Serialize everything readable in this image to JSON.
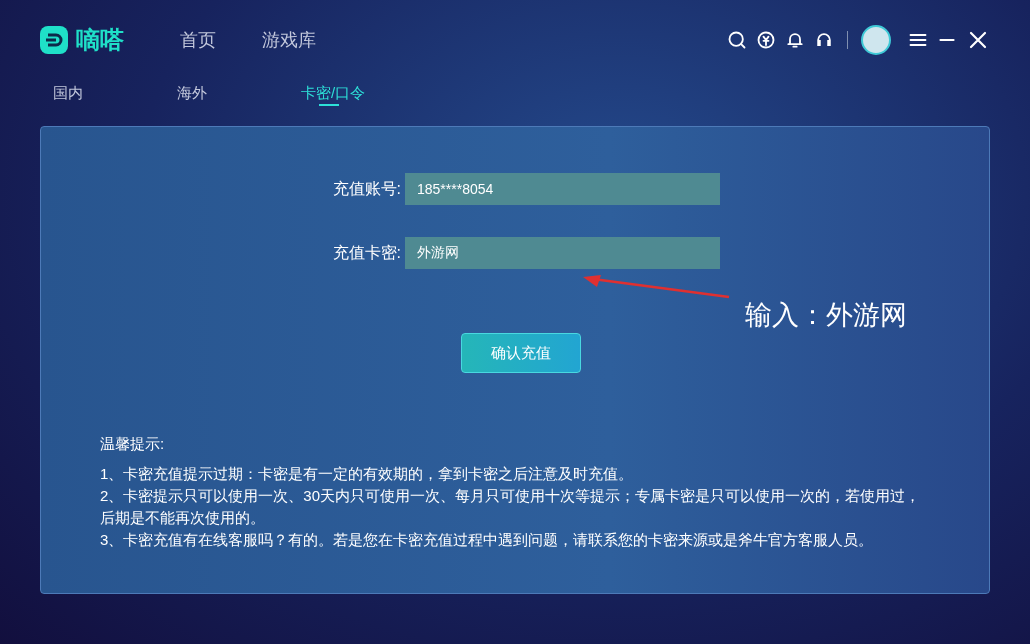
{
  "app": {
    "logo_text": "嘀嗒"
  },
  "nav": [
    {
      "label": "首页",
      "selected": false
    },
    {
      "label": "游戏库",
      "selected": false
    }
  ],
  "subtabs": [
    {
      "label": "国内",
      "selected": false
    },
    {
      "label": "海外",
      "selected": false
    },
    {
      "label": "卡密/口令",
      "selected": true
    }
  ],
  "form": {
    "fields": [
      {
        "label": "充值账号:",
        "value": "185****8054"
      },
      {
        "label": "充值卡密:",
        "value": "外游网"
      }
    ],
    "submit": "确认充值"
  },
  "annotation": {
    "text": "输入：外游网"
  },
  "notes": {
    "title": "温馨提示:",
    "items": [
      "1、卡密充值提示过期：卡密是有一定的有效期的，拿到卡密之后注意及时充值。",
      "2、卡密提示只可以使用一次、30天内只可使用一次、每月只可使用十次等提示；专属卡密是只可以使用一次的，若使用过，后期是不能再次使用的。",
      "3、卡密充值有在线客服吗？有的。若是您在卡密充值过程中遇到问题，请联系您的卡密来源或是斧牛官方客服人员。"
    ]
  }
}
